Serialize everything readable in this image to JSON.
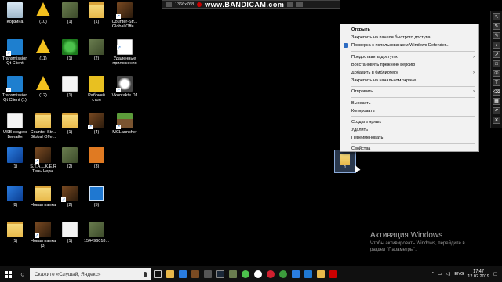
{
  "recorder": {
    "brand": "www.BANDICAM.com",
    "resolution": "1366x768"
  },
  "desktop_icons": [
    {
      "label": "Корзина",
      "type": "bin"
    },
    {
      "label": "(10)",
      "type": "warn"
    },
    {
      "label": "(1)",
      "type": "photo"
    },
    {
      "label": "(1)",
      "type": "folder"
    },
    {
      "label": "Counter-Str... Global Offe...",
      "type": "game"
    },
    {
      "label": "Transmission Qt Client",
      "type": "qt"
    },
    {
      "label": "(11)",
      "type": "warn"
    },
    {
      "label": "(1)",
      "type": "green"
    },
    {
      "label": "(2)",
      "type": "photo"
    },
    {
      "label": "Удаленные приложения",
      "type": "html"
    },
    {
      "label": "Transmission Qt Client (1)",
      "type": "qt"
    },
    {
      "label": "(12)",
      "type": "warn"
    },
    {
      "label": "(1)",
      "type": "file"
    },
    {
      "label": "Рабочий стол",
      "type": "yellow"
    },
    {
      "label": "Vkontakte DJ",
      "type": "vk"
    },
    {
      "label": "USB-модем Билайн",
      "type": "file"
    },
    {
      "label": "Counter-Str... Global Offe...",
      "type": "folder"
    },
    {
      "label": "(1)",
      "type": "folder"
    },
    {
      "label": "(4)",
      "type": "game"
    },
    {
      "label": "MCLauncher",
      "type": "mc"
    },
    {
      "label": "(1)",
      "type": "blue"
    },
    {
      "label": "S.T.A.L.K.E.R. Тень Черн...",
      "type": "game"
    },
    {
      "label": "(2)",
      "type": "photo"
    },
    {
      "label": "(3)",
      "type": "orange"
    },
    {
      "label": "(8)",
      "type": "blue"
    },
    {
      "label": "Новая папка",
      "type": "folder"
    },
    {
      "label": "(2)",
      "type": "game"
    },
    {
      "label": "(5)",
      "type": "screen"
    },
    {
      "label": "(1)",
      "type": "folder"
    },
    {
      "label": "Новая папка (3)",
      "type": "game"
    },
    {
      "label": "(1)",
      "type": "file"
    },
    {
      "label": "154496018...",
      "type": "photo"
    }
  ],
  "context_menu": {
    "items": [
      {
        "label": "Открыть",
        "bold": true
      },
      {
        "label": "Закрепить на панели быстрого доступа"
      },
      {
        "label": "Проверка с использованием Windows Defender...",
        "icon": "shield-icon"
      },
      {
        "sep": true
      },
      {
        "label": "Предоставить доступ к",
        "submenu": true
      },
      {
        "label": "Восстановить прежнюю версию"
      },
      {
        "label": "Добавить в библиотеку",
        "submenu": true
      },
      {
        "label": "Закрепить на начальном экране"
      },
      {
        "sep": true
      },
      {
        "label": "Отправить",
        "submenu": true
      },
      {
        "sep": true
      },
      {
        "label": "Вырезать"
      },
      {
        "label": "Копировать"
      },
      {
        "sep": true
      },
      {
        "label": "Создать ярлык"
      },
      {
        "label": "Удалить"
      },
      {
        "label": "Переименовать"
      },
      {
        "sep": true
      },
      {
        "label": "Свойства"
      }
    ]
  },
  "selected_file": {
    "label": "1"
  },
  "watermark": {
    "title": "Активация Windows",
    "line1": "Чтобы активировать Windows, перейдите в",
    "line2": "раздел \"Параметры\"."
  },
  "taskbar": {
    "search_placeholder": "Скажите «Слушай, Яндекс»",
    "language": "ENG",
    "time": "17:47",
    "date": "12.02.2019"
  },
  "colors": {
    "selection": "#89a9d8",
    "taskbar": "#101010",
    "menu_bg": "#f2f2f2"
  }
}
